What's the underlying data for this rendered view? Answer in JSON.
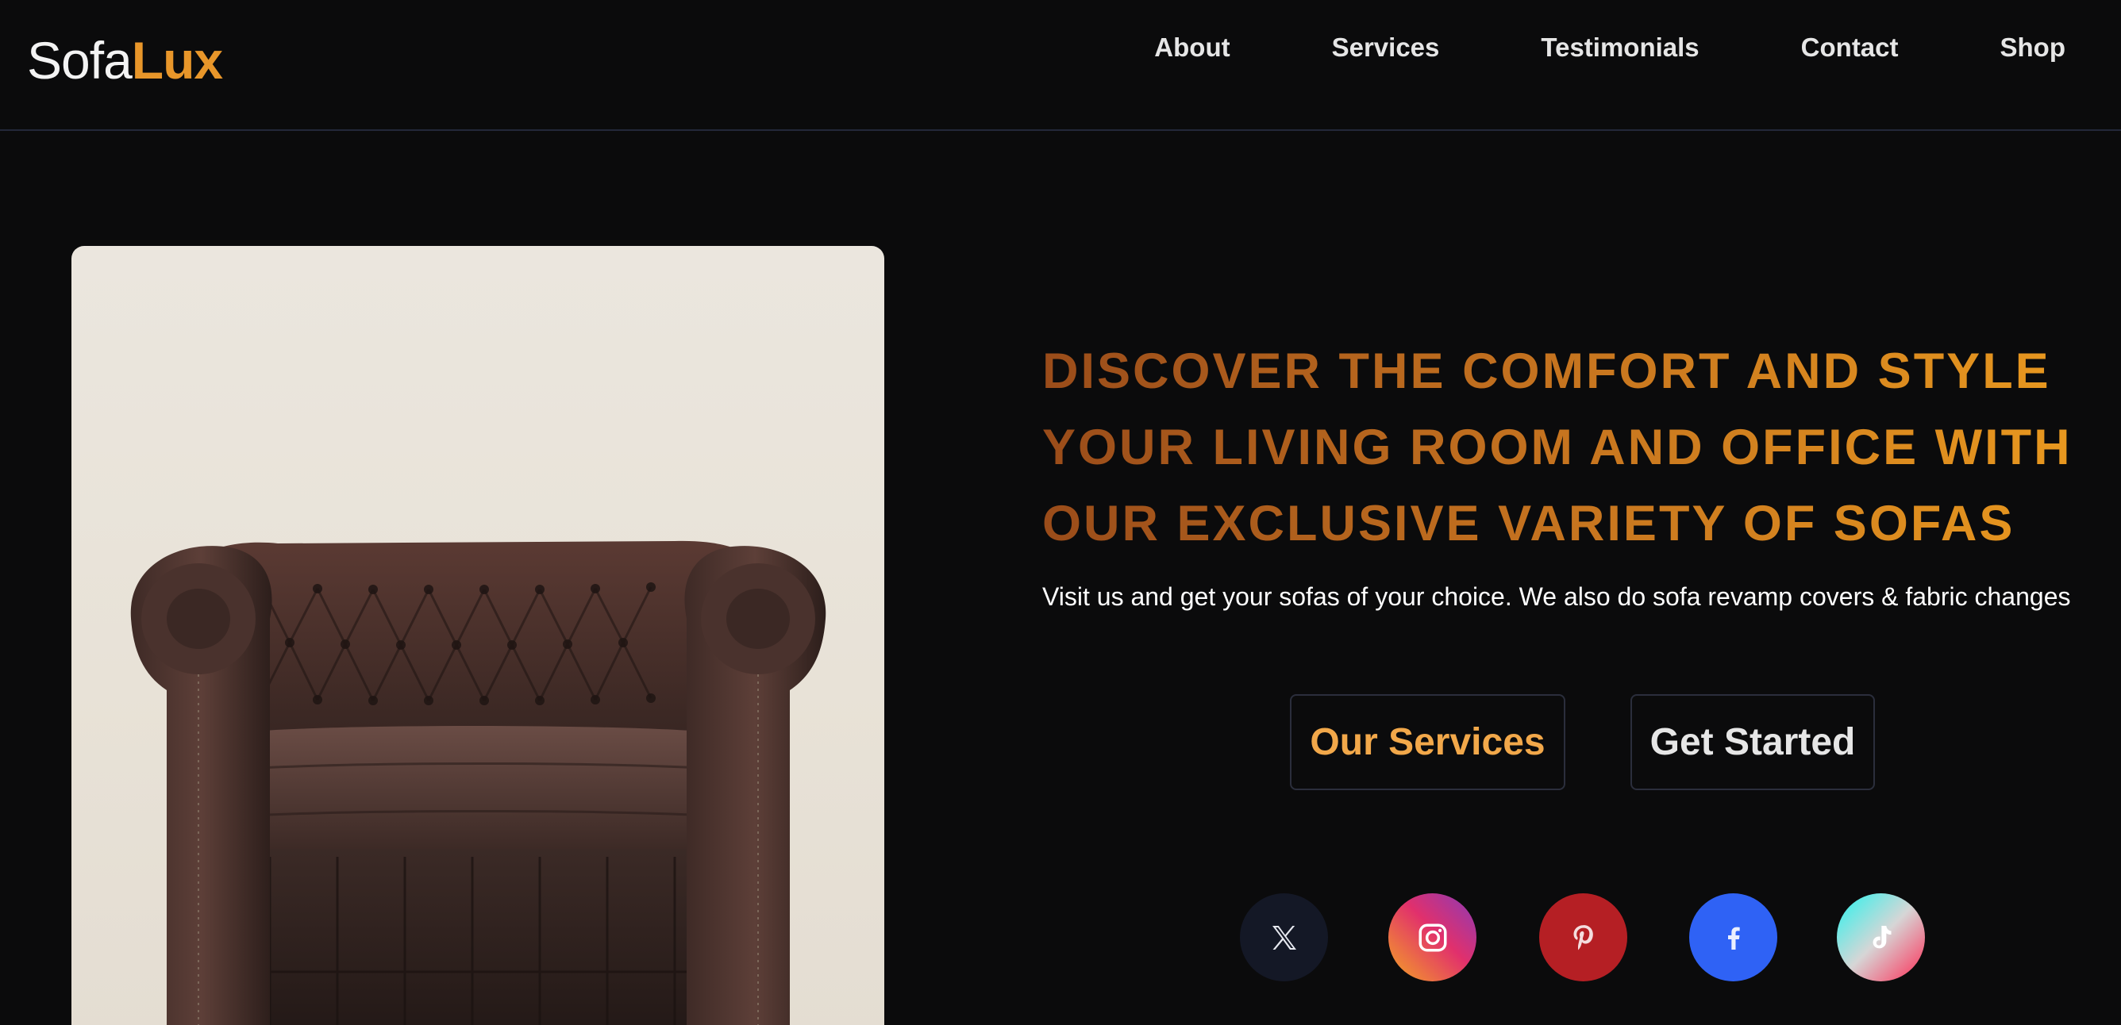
{
  "brand": {
    "part1": "Sofa",
    "part2": "Lux",
    "accent_color": "#e8962a"
  },
  "nav": {
    "items": [
      {
        "label": "About"
      },
      {
        "label": "Services"
      },
      {
        "label": "Testimonials"
      },
      {
        "label": "Contact"
      },
      {
        "label": "Shop"
      }
    ]
  },
  "hero": {
    "image": {
      "subject": "brown leather chesterfield armchair"
    },
    "headline_lines": [
      "DISCOVER THE COMFORT AND STYLE",
      "YOUR LIVING ROOM AND OFFICE WITH",
      "OUR EXCLUSIVE VARIETY OF SOFAS"
    ],
    "subtext": "Visit us and get your sofas of your choice. We also do sofa revamp covers & fabric changes",
    "buttons": {
      "services_label": "Our Services",
      "start_label": "Get Started"
    }
  },
  "socials": [
    {
      "icon": "x-icon",
      "color": "#141826"
    },
    {
      "icon": "instagram-icon",
      "color": "#e1306c"
    },
    {
      "icon": "pinterest-icon",
      "color": "#b51f24"
    },
    {
      "icon": "facebook-icon",
      "color": "#2f62f5"
    },
    {
      "icon": "tiktok-icon",
      "color": "#25f4ee"
    }
  ]
}
